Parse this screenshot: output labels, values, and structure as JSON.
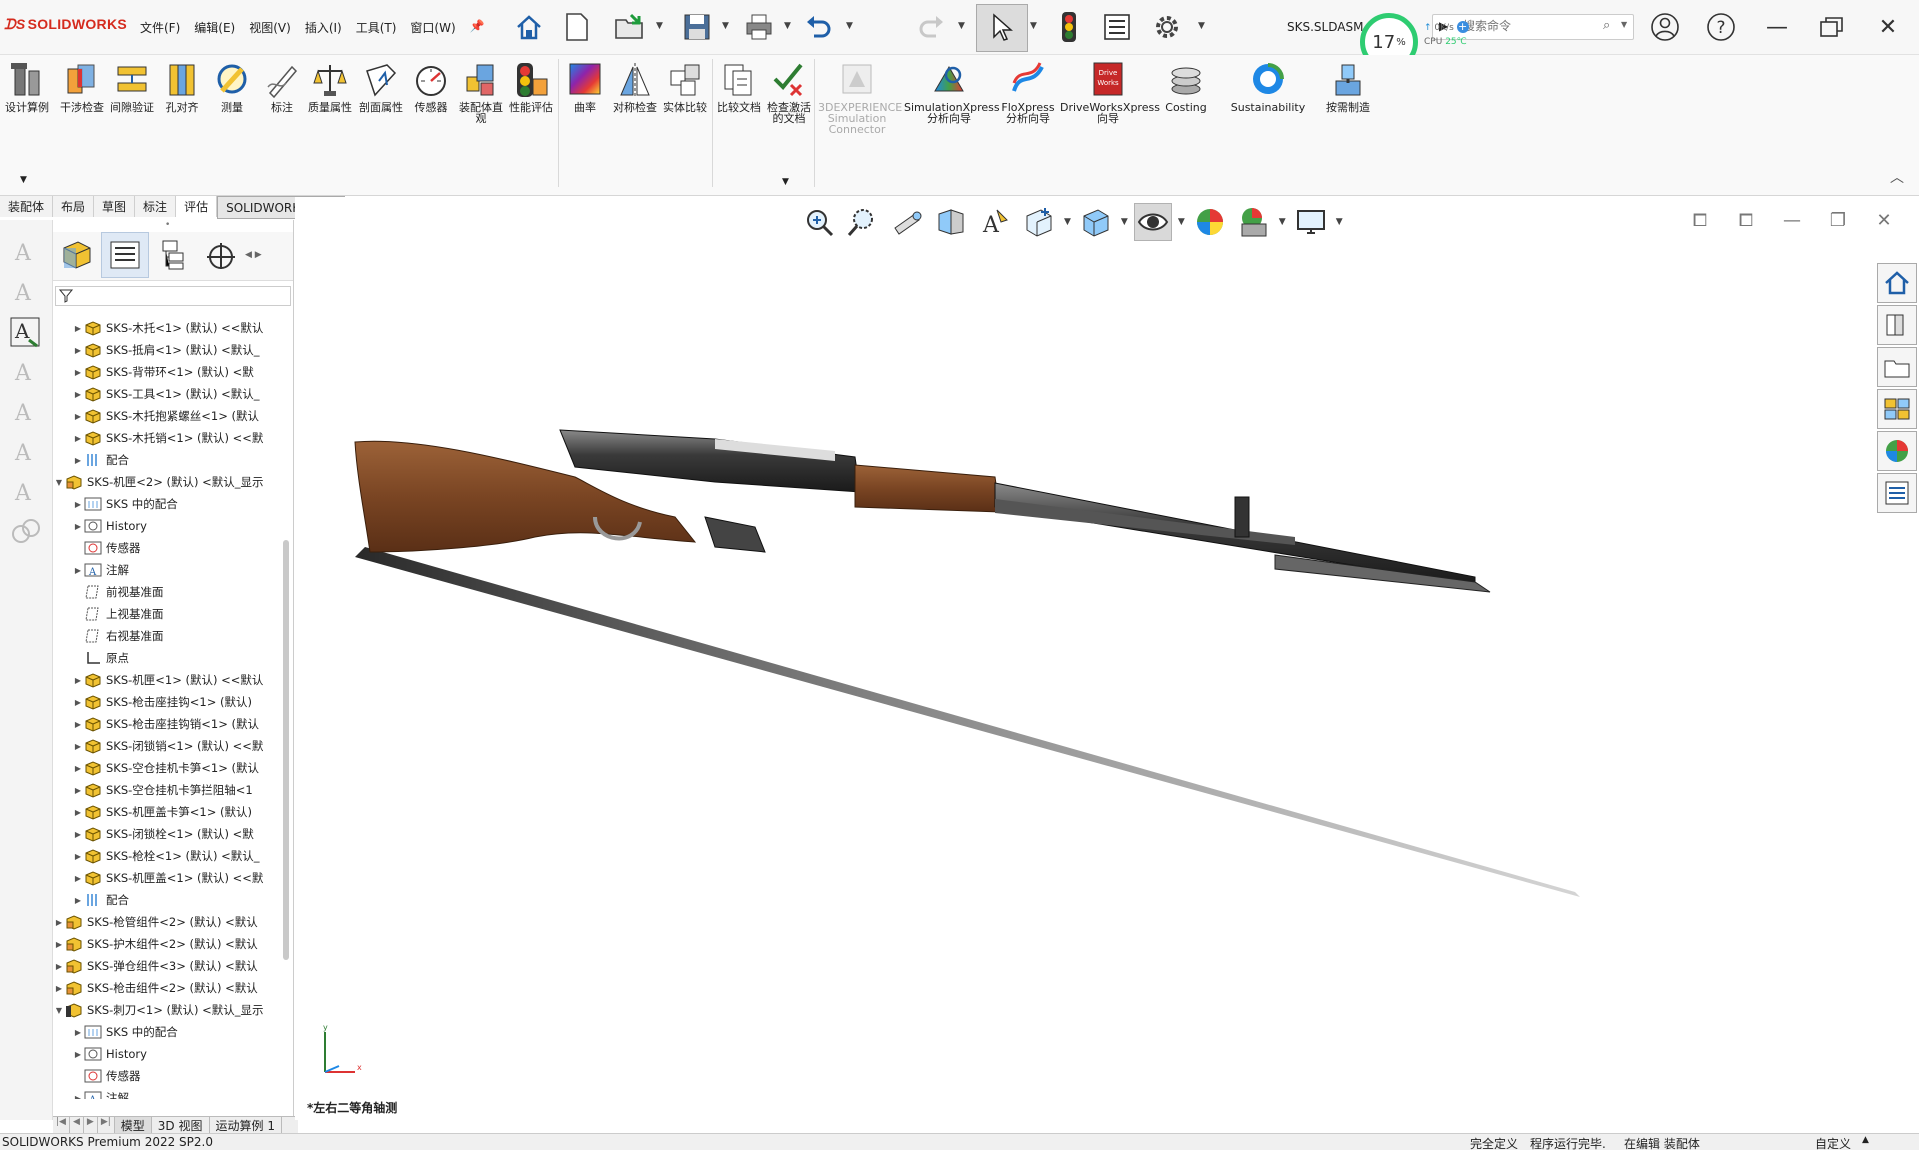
{
  "app": {
    "brand": "SOLIDWORKS",
    "menu": [
      "文件(F)",
      "编辑(E)",
      "视图(V)",
      "插入(I)",
      "工具(T)",
      "窗口(W)"
    ],
    "document_title": "SKS.SLDASM *",
    "search_placeholder": "搜索命令",
    "cpu_percent": "17",
    "cpu_percent_sign": "%",
    "net_speed": "0K/s",
    "cpu_label": "CPU",
    "cpu_temp": "25℃"
  },
  "commands": [
    {
      "label": "设计算例"
    },
    {
      "label": "干涉检查"
    },
    {
      "label": "间隙验证"
    },
    {
      "label": "孔对齐"
    },
    {
      "label": "测量"
    },
    {
      "label": "标注"
    },
    {
      "label": "质量属性"
    },
    {
      "label": "剖面属性"
    },
    {
      "label": "传感器"
    },
    {
      "label": "装配体直观"
    },
    {
      "label": "性能评估"
    },
    {
      "label": "曲率"
    },
    {
      "label": "对称检查"
    },
    {
      "label": "实体比较"
    },
    {
      "label": "比较文档"
    },
    {
      "label": "检查激活的文档"
    },
    {
      "label": "3DEXPERIENCE Simulation Connector"
    },
    {
      "label": "SimulationXpress 分析向导"
    },
    {
      "label": "FloXpress 分析向导"
    },
    {
      "label": "DriveWorksXpress 向导"
    },
    {
      "label": "Costing"
    },
    {
      "label": "Sustainability"
    },
    {
      "label": "按需制造"
    }
  ],
  "command_tabs": [
    "装配体",
    "布局",
    "草图",
    "标注",
    "评估",
    "SOLIDWORKS 插件"
  ],
  "tree": [
    {
      "label": "SKS-木托<1> (默认) <<默认",
      "indent": 1,
      "icon": "part",
      "toggle": "closed"
    },
    {
      "label": "SKS-抵肩<1> (默认) <默认_",
      "indent": 1,
      "icon": "part",
      "toggle": "closed"
    },
    {
      "label": "SKS-背带环<1> (默认) <默",
      "indent": 1,
      "icon": "part",
      "toggle": "closed"
    },
    {
      "label": "SKS-工具<1> (默认) <默认_",
      "indent": 1,
      "icon": "part",
      "toggle": "closed"
    },
    {
      "label": "SKS-木托抱紧螺丝<1> (默认",
      "indent": 1,
      "icon": "part",
      "toggle": "closed"
    },
    {
      "label": "SKS-木托销<1> (默认) <<默",
      "indent": 1,
      "icon": "part",
      "toggle": "closed"
    },
    {
      "label": "配合",
      "indent": 1,
      "icon": "mates",
      "toggle": "closed"
    },
    {
      "label": "SKS-机匣<2> (默认) <默认_显示",
      "indent": 0,
      "icon": "assembly",
      "toggle": "open"
    },
    {
      "label": "SKS 中的配合",
      "indent": 1,
      "icon": "mates-in",
      "toggle": "closed"
    },
    {
      "label": "History",
      "indent": 1,
      "icon": "history",
      "toggle": "closed"
    },
    {
      "label": "传感器",
      "indent": 1,
      "icon": "sensor",
      "toggle": "none"
    },
    {
      "label": "注解",
      "indent": 1,
      "icon": "annotation",
      "toggle": "closed"
    },
    {
      "label": "前视基准面",
      "indent": 1,
      "icon": "plane",
      "toggle": "none"
    },
    {
      "label": "上视基准面",
      "indent": 1,
      "icon": "plane",
      "toggle": "none"
    },
    {
      "label": "右视基准面",
      "indent": 1,
      "icon": "plane",
      "toggle": "none"
    },
    {
      "label": "原点",
      "indent": 1,
      "icon": "origin",
      "toggle": "none"
    },
    {
      "label": "SKS-机匣<1> (默认) <<默认",
      "indent": 1,
      "icon": "part",
      "toggle": "closed"
    },
    {
      "label": "SKS-枪击座挂钩<1> (默认)",
      "indent": 1,
      "icon": "part",
      "toggle": "closed"
    },
    {
      "label": "SKS-枪击座挂钩销<1> (默认",
      "indent": 1,
      "icon": "part",
      "toggle": "closed"
    },
    {
      "label": "SKS-闭锁销<1> (默认) <<默",
      "indent": 1,
      "icon": "part",
      "toggle": "closed"
    },
    {
      "label": "SKS-空仓挂机卡笋<1> (默认",
      "indent": 1,
      "icon": "part",
      "toggle": "closed"
    },
    {
      "label": "SKS-空仓挂机卡笋拦阻轴<1",
      "indent": 1,
      "icon": "part",
      "toggle": "closed"
    },
    {
      "label": "SKS-机匣盖卡笋<1> (默认)",
      "indent": 1,
      "icon": "part",
      "toggle": "closed"
    },
    {
      "label": "SKS-闭锁栓<1> (默认) <默",
      "indent": 1,
      "icon": "part",
      "toggle": "closed"
    },
    {
      "label": "SKS-枪栓<1> (默认) <默认_",
      "indent": 1,
      "icon": "part",
      "toggle": "closed"
    },
    {
      "label": "SKS-机匣盖<1> (默认) <<默",
      "indent": 1,
      "icon": "part",
      "toggle": "closed"
    },
    {
      "label": "配合",
      "indent": 1,
      "icon": "mates",
      "toggle": "closed"
    },
    {
      "label": "SKS-枪管组件<2> (默认) <默认",
      "indent": 0,
      "icon": "assembly",
      "toggle": "closed"
    },
    {
      "label": "SKS-护木组件<2> (默认) <默认",
      "indent": 0,
      "icon": "assembly",
      "toggle": "closed"
    },
    {
      "label": "SKS-弹仓组件<3> (默认) <默认",
      "indent": 0,
      "icon": "assembly",
      "toggle": "closed"
    },
    {
      "label": "SKS-枪击组件<2> (默认) <默认",
      "indent": 0,
      "icon": "assembly",
      "toggle": "closed"
    },
    {
      "label": "SKS-刺刀<1> (默认) <默认_显示",
      "indent": 0,
      "icon": "assembly-warn",
      "toggle": "open"
    },
    {
      "label": "SKS 中的配合",
      "indent": 1,
      "icon": "mates-in",
      "toggle": "closed"
    },
    {
      "label": "History",
      "indent": 1,
      "icon": "history",
      "toggle": "closed"
    },
    {
      "label": "传感器",
      "indent": 1,
      "icon": "sensor",
      "toggle": "none"
    },
    {
      "label": "注解",
      "indent": 1,
      "icon": "annotation",
      "toggle": "closed"
    }
  ],
  "bottom_tabs": [
    "模型",
    "3D 视图",
    "运动算例 1"
  ],
  "graphics": {
    "view_label": "*左右二等角轴测",
    "triad_x": "x",
    "triad_y": "y"
  },
  "status": {
    "version": "SOLIDWORKS Premium 2022 SP2.0",
    "definition": "完全定义",
    "program_state": "程序运行完毕.",
    "editing": "在编辑 装配体",
    "units": "自定义"
  }
}
